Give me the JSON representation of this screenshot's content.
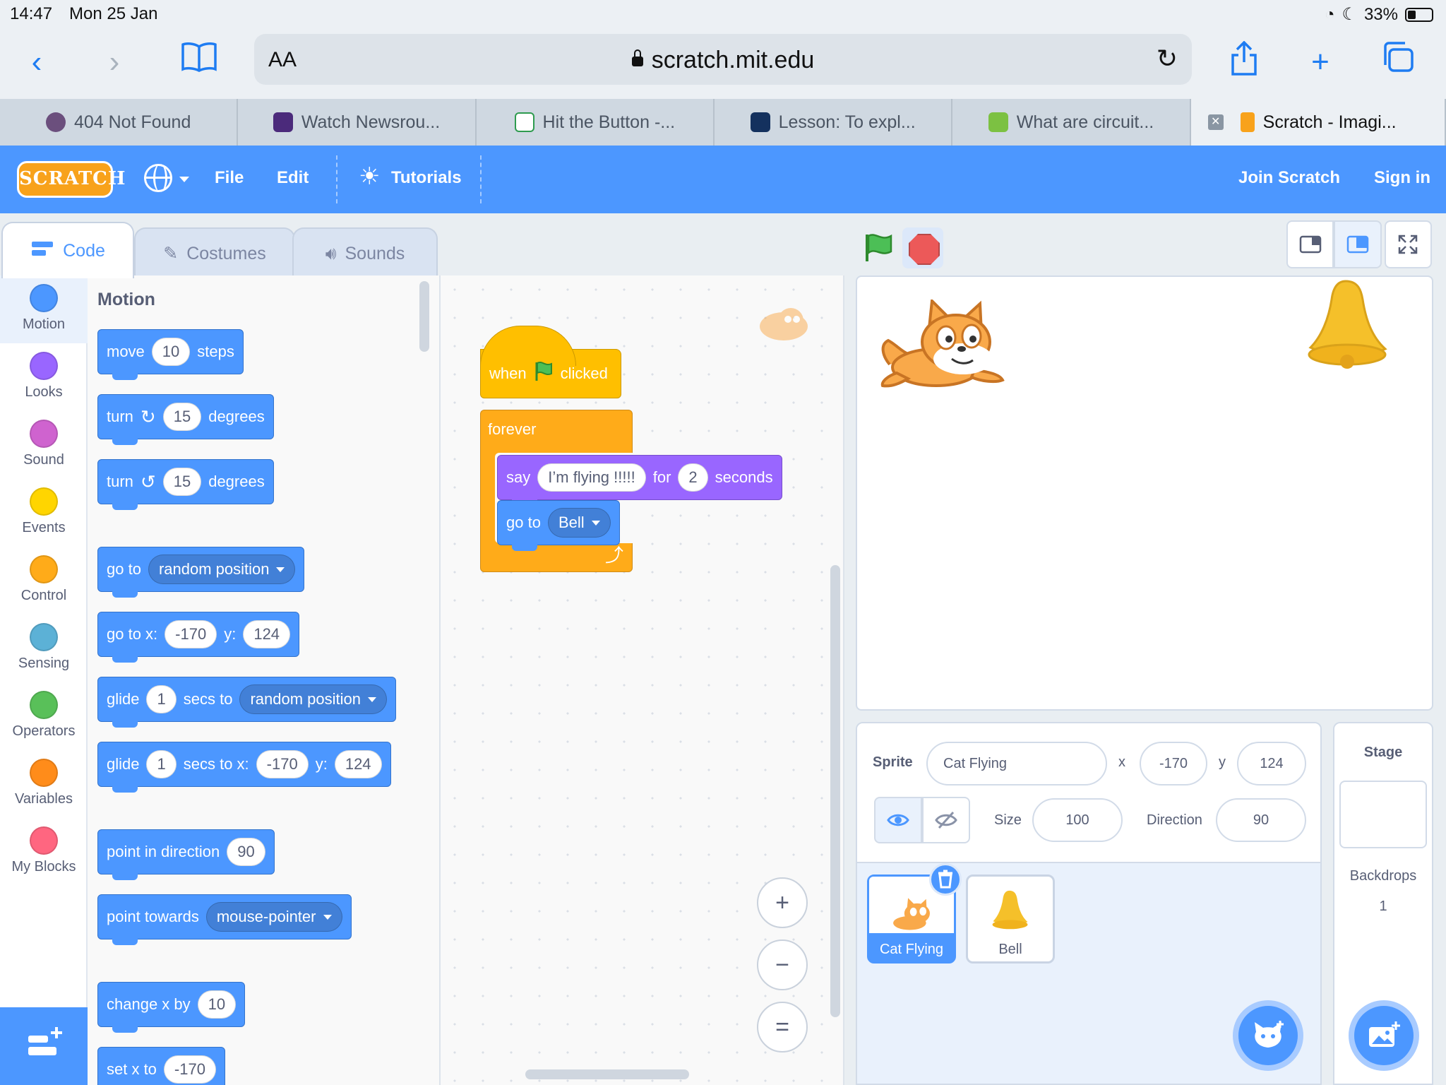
{
  "status": {
    "time": "14:47",
    "date": "Mon 25 Jan",
    "battery": "33%"
  },
  "browser": {
    "aa": "AA",
    "url": "scratch.mit.edu",
    "tabs": [
      {
        "label": "404 Not Found"
      },
      {
        "label": "Watch Newsrou..."
      },
      {
        "label": "Hit the Button -..."
      },
      {
        "label": "Lesson: To expl..."
      },
      {
        "label": "What are circuit..."
      },
      {
        "label": "Scratch - Imagi..."
      }
    ]
  },
  "menu": {
    "logo": "SCRATCH",
    "file": "File",
    "edit": "Edit",
    "tutorials": "Tutorials",
    "join": "Join Scratch",
    "signin": "Sign in"
  },
  "editor_tabs": {
    "code": "Code",
    "costumes": "Costumes",
    "sounds": "Sounds"
  },
  "categories": [
    {
      "label": "Motion",
      "color": "#4c97ff"
    },
    {
      "label": "Looks",
      "color": "#9966ff"
    },
    {
      "label": "Sound",
      "color": "#cf63cf"
    },
    {
      "label": "Events",
      "color": "#ffd500"
    },
    {
      "label": "Control",
      "color": "#ffab19"
    },
    {
      "label": "Sensing",
      "color": "#5cb1d6"
    },
    {
      "label": "Operators",
      "color": "#59c059"
    },
    {
      "label": "Variables",
      "color": "#ff8c1a"
    },
    {
      "label": "My Blocks",
      "color": "#ff6680"
    }
  ],
  "palette": {
    "heading": "Motion",
    "move": {
      "a": "move",
      "n": "10",
      "b": "steps"
    },
    "turn_right": {
      "a": "turn",
      "n": "15",
      "b": "degrees"
    },
    "turn_left": {
      "a": "turn",
      "n": "15",
      "b": "degrees"
    },
    "goto": {
      "a": "go to",
      "opt": "random position"
    },
    "gotoxy": {
      "a": "go to x:",
      "x": "-170",
      "yl": "y:",
      "y": "124"
    },
    "glide1": {
      "a": "glide",
      "n": "1",
      "b": "secs to",
      "opt": "random position"
    },
    "glide2": {
      "a": "glide",
      "n": "1",
      "b": "secs to x:",
      "x": "-170",
      "yl": "y:",
      "y": "124"
    },
    "point_dir": {
      "a": "point in direction",
      "n": "90"
    },
    "point_towards": {
      "a": "point towards",
      "opt": "mouse-pointer"
    },
    "change_x": {
      "a": "change x by",
      "n": "10"
    },
    "set_x": {
      "a": "set x to",
      "n": "-170"
    }
  },
  "script": {
    "hat": {
      "a": "when",
      "b": "clicked"
    },
    "forever": "forever",
    "say": {
      "a": "say",
      "msg": "I’m flying !!!!!",
      "b": "for",
      "n": "2",
      "c": "seconds"
    },
    "goto": {
      "a": "go to",
      "opt": "Bell"
    }
  },
  "zoom": {
    "in": "+",
    "out": "−",
    "reset": "="
  },
  "sprite_info": {
    "sprite_label": "Sprite",
    "sprite_name": "Cat Flying",
    "x_label": "x",
    "x": "-170",
    "y_label": "y",
    "y": "124",
    "size_label": "Size",
    "size": "100",
    "direction_label": "Direction",
    "direction": "90"
  },
  "sprites": [
    {
      "name": "Cat Flying"
    },
    {
      "name": "Bell"
    }
  ],
  "stage_pane": {
    "title": "Stage",
    "backdrops_label": "Backdrops",
    "backdrops_count": "1"
  },
  "colors": {
    "scratch_blue": "#4c97ff",
    "events": "#ffbf00",
    "control": "#ffab19",
    "looks": "#9966ff"
  }
}
